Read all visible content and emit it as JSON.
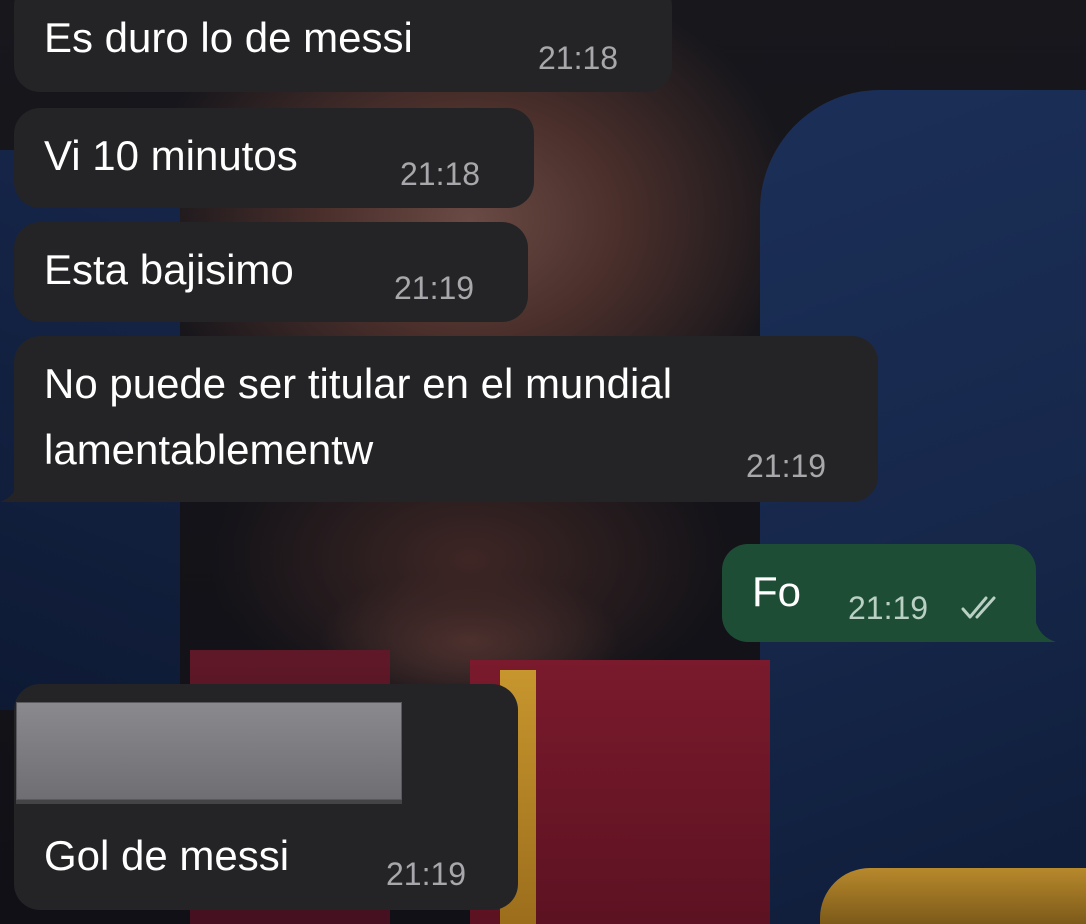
{
  "messages": [
    {
      "direction": "incoming",
      "text": "Es duro lo de messi",
      "time": "21:18"
    },
    {
      "direction": "incoming",
      "text": "Vi 10 minutos",
      "time": "21:18"
    },
    {
      "direction": "incoming",
      "text": "Esta bajisimo",
      "time": "21:19"
    },
    {
      "direction": "incoming",
      "text_line1": "No puede ser titular en el mundial",
      "text_line2": "lamentablementw",
      "time": "21:19"
    },
    {
      "direction": "outgoing",
      "text": "Fo",
      "time": "21:19",
      "status": "read",
      "status_icon": "double-check-icon"
    },
    {
      "direction": "incoming",
      "text": "Gol de messi",
      "time": "21:19",
      "attachment": "redacted-preview"
    }
  ],
  "colors": {
    "incoming_bubble": "#242426",
    "outgoing_bubble": "#1e4d36",
    "text": "#ffffff",
    "timestamp": "#a8a8ac"
  }
}
